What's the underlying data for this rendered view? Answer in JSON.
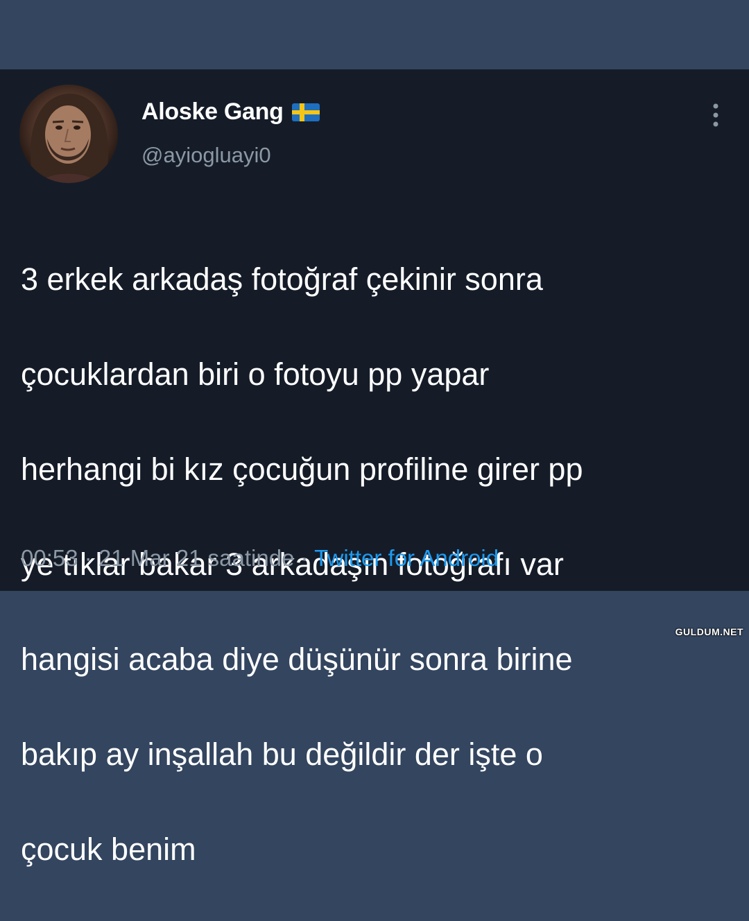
{
  "tweet": {
    "display_name": "Aloske Gang",
    "flag_icon": "sweden-flag-icon",
    "handle": "@ayiogluayi0",
    "text_lines": [
      "3 erkek arkadaş fotoğraf çekinir sonra",
      "çocuklardan biri o fotoyu pp yapar",
      "herhangi bi kız çocuğun profiline girer pp",
      "ye tıklar bakar 3 arkadaşın fotoğrafı var",
      "hangisi acaba diye düşünür sonra birine",
      "bakıp ay inşallah bu değildir der işte o",
      "çocuk benim"
    ],
    "time": "00:53",
    "separator": " · ",
    "date": "21 Mar 21 saatinde",
    "source": "Twitter for Android"
  },
  "watermark": "GULDUM.NET",
  "colors": {
    "band_background": "#33455f",
    "card_background": "#151c28",
    "primary_text": "#ffffff",
    "secondary_text": "#8b98a5",
    "link": "#1d9bf0"
  }
}
